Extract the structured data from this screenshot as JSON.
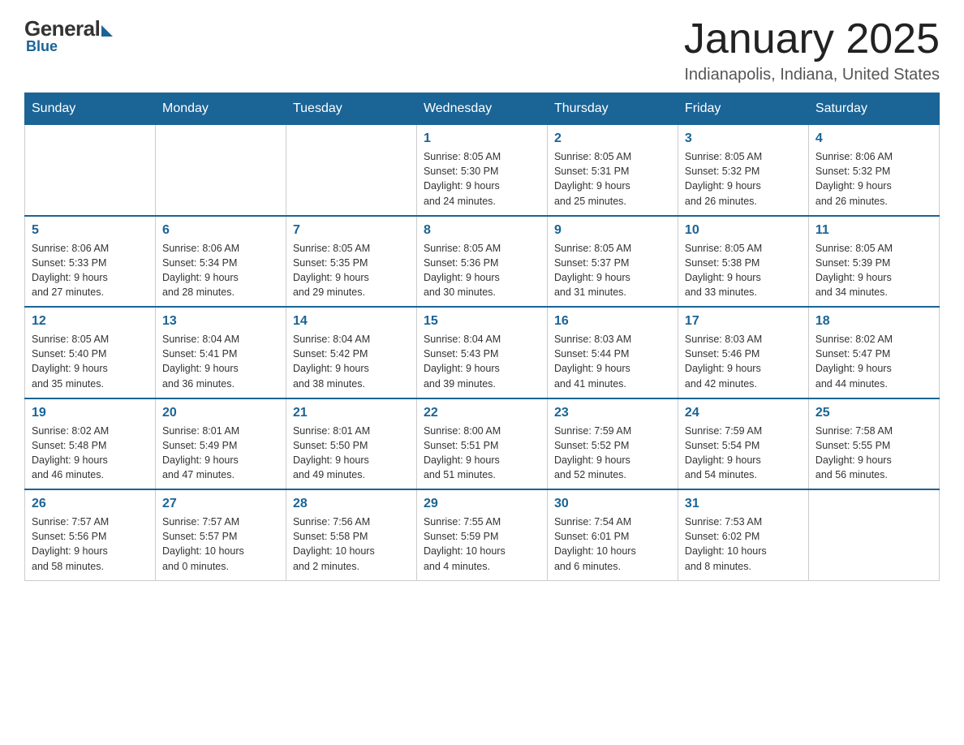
{
  "header": {
    "logo_general": "General",
    "logo_blue": "Blue",
    "month_title": "January 2025",
    "location": "Indianapolis, Indiana, United States"
  },
  "days_of_week": [
    "Sunday",
    "Monday",
    "Tuesday",
    "Wednesday",
    "Thursday",
    "Friday",
    "Saturday"
  ],
  "weeks": [
    [
      {
        "day": "",
        "info": ""
      },
      {
        "day": "",
        "info": ""
      },
      {
        "day": "",
        "info": ""
      },
      {
        "day": "1",
        "info": "Sunrise: 8:05 AM\nSunset: 5:30 PM\nDaylight: 9 hours\nand 24 minutes."
      },
      {
        "day": "2",
        "info": "Sunrise: 8:05 AM\nSunset: 5:31 PM\nDaylight: 9 hours\nand 25 minutes."
      },
      {
        "day": "3",
        "info": "Sunrise: 8:05 AM\nSunset: 5:32 PM\nDaylight: 9 hours\nand 26 minutes."
      },
      {
        "day": "4",
        "info": "Sunrise: 8:06 AM\nSunset: 5:32 PM\nDaylight: 9 hours\nand 26 minutes."
      }
    ],
    [
      {
        "day": "5",
        "info": "Sunrise: 8:06 AM\nSunset: 5:33 PM\nDaylight: 9 hours\nand 27 minutes."
      },
      {
        "day": "6",
        "info": "Sunrise: 8:06 AM\nSunset: 5:34 PM\nDaylight: 9 hours\nand 28 minutes."
      },
      {
        "day": "7",
        "info": "Sunrise: 8:05 AM\nSunset: 5:35 PM\nDaylight: 9 hours\nand 29 minutes."
      },
      {
        "day": "8",
        "info": "Sunrise: 8:05 AM\nSunset: 5:36 PM\nDaylight: 9 hours\nand 30 minutes."
      },
      {
        "day": "9",
        "info": "Sunrise: 8:05 AM\nSunset: 5:37 PM\nDaylight: 9 hours\nand 31 minutes."
      },
      {
        "day": "10",
        "info": "Sunrise: 8:05 AM\nSunset: 5:38 PM\nDaylight: 9 hours\nand 33 minutes."
      },
      {
        "day": "11",
        "info": "Sunrise: 8:05 AM\nSunset: 5:39 PM\nDaylight: 9 hours\nand 34 minutes."
      }
    ],
    [
      {
        "day": "12",
        "info": "Sunrise: 8:05 AM\nSunset: 5:40 PM\nDaylight: 9 hours\nand 35 minutes."
      },
      {
        "day": "13",
        "info": "Sunrise: 8:04 AM\nSunset: 5:41 PM\nDaylight: 9 hours\nand 36 minutes."
      },
      {
        "day": "14",
        "info": "Sunrise: 8:04 AM\nSunset: 5:42 PM\nDaylight: 9 hours\nand 38 minutes."
      },
      {
        "day": "15",
        "info": "Sunrise: 8:04 AM\nSunset: 5:43 PM\nDaylight: 9 hours\nand 39 minutes."
      },
      {
        "day": "16",
        "info": "Sunrise: 8:03 AM\nSunset: 5:44 PM\nDaylight: 9 hours\nand 41 minutes."
      },
      {
        "day": "17",
        "info": "Sunrise: 8:03 AM\nSunset: 5:46 PM\nDaylight: 9 hours\nand 42 minutes."
      },
      {
        "day": "18",
        "info": "Sunrise: 8:02 AM\nSunset: 5:47 PM\nDaylight: 9 hours\nand 44 minutes."
      }
    ],
    [
      {
        "day": "19",
        "info": "Sunrise: 8:02 AM\nSunset: 5:48 PM\nDaylight: 9 hours\nand 46 minutes."
      },
      {
        "day": "20",
        "info": "Sunrise: 8:01 AM\nSunset: 5:49 PM\nDaylight: 9 hours\nand 47 minutes."
      },
      {
        "day": "21",
        "info": "Sunrise: 8:01 AM\nSunset: 5:50 PM\nDaylight: 9 hours\nand 49 minutes."
      },
      {
        "day": "22",
        "info": "Sunrise: 8:00 AM\nSunset: 5:51 PM\nDaylight: 9 hours\nand 51 minutes."
      },
      {
        "day": "23",
        "info": "Sunrise: 7:59 AM\nSunset: 5:52 PM\nDaylight: 9 hours\nand 52 minutes."
      },
      {
        "day": "24",
        "info": "Sunrise: 7:59 AM\nSunset: 5:54 PM\nDaylight: 9 hours\nand 54 minutes."
      },
      {
        "day": "25",
        "info": "Sunrise: 7:58 AM\nSunset: 5:55 PM\nDaylight: 9 hours\nand 56 minutes."
      }
    ],
    [
      {
        "day": "26",
        "info": "Sunrise: 7:57 AM\nSunset: 5:56 PM\nDaylight: 9 hours\nand 58 minutes."
      },
      {
        "day": "27",
        "info": "Sunrise: 7:57 AM\nSunset: 5:57 PM\nDaylight: 10 hours\nand 0 minutes."
      },
      {
        "day": "28",
        "info": "Sunrise: 7:56 AM\nSunset: 5:58 PM\nDaylight: 10 hours\nand 2 minutes."
      },
      {
        "day": "29",
        "info": "Sunrise: 7:55 AM\nSunset: 5:59 PM\nDaylight: 10 hours\nand 4 minutes."
      },
      {
        "day": "30",
        "info": "Sunrise: 7:54 AM\nSunset: 6:01 PM\nDaylight: 10 hours\nand 6 minutes."
      },
      {
        "day": "31",
        "info": "Sunrise: 7:53 AM\nSunset: 6:02 PM\nDaylight: 10 hours\nand 8 minutes."
      },
      {
        "day": "",
        "info": ""
      }
    ]
  ]
}
